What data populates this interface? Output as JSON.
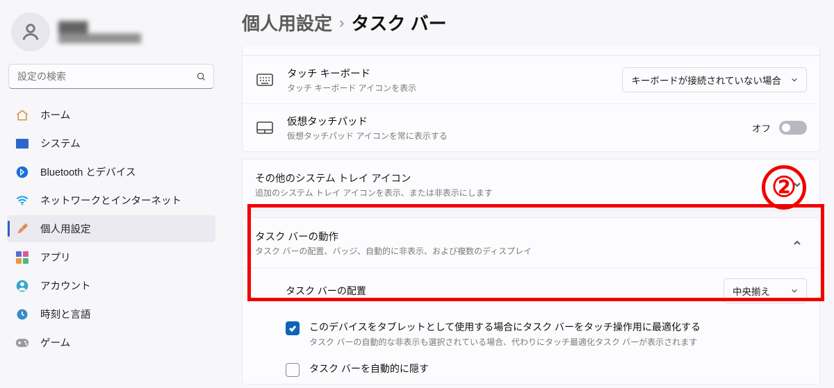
{
  "profile": {
    "name_blur": "████",
    "sub_blur": "██████████████"
  },
  "search": {
    "placeholder": "設定の検索"
  },
  "sidebar": {
    "items": [
      {
        "label": "ホーム",
        "icon": "home"
      },
      {
        "label": "システム",
        "icon": "system"
      },
      {
        "label": "Bluetooth とデバイス",
        "icon": "bt"
      },
      {
        "label": "ネットワークとインターネット",
        "icon": "wifi"
      },
      {
        "label": "個人用設定",
        "icon": "personalize",
        "active": true
      },
      {
        "label": "アプリ",
        "icon": "apps"
      },
      {
        "label": "アカウント",
        "icon": "account"
      },
      {
        "label": "時刻と言語",
        "icon": "time"
      },
      {
        "label": "ゲーム",
        "icon": "game"
      }
    ]
  },
  "breadcrumb": {
    "parent": "個人用設定",
    "sep": "›",
    "current": "タスク バー"
  },
  "rows": {
    "touch_kb": {
      "title": "タッチ キーボード",
      "sub": "タッチ キーボード アイコンを表示",
      "dropdown": "キーボードが接続されていない場合"
    },
    "vtouch": {
      "title": "仮想タッチパッド",
      "sub": "仮想タッチパッド アイコンを常に表示する",
      "toggle_label": "オフ",
      "toggle_on": false
    }
  },
  "tray": {
    "title": "その他のシステム トレイ アイコン",
    "sub": "追加のシステム トレイ アイコンを表示、または非表示にします"
  },
  "behavior": {
    "title": "タスク バーの動作",
    "sub": "タスク バーの配置、バッジ、自動的に非表示、および複数のディスプレイ",
    "alignment": {
      "label": "タスク バーの配置",
      "value": "中央揃え"
    },
    "tablet": {
      "label": "このデバイスをタブレットとして使用する場合にタスク バーをタッチ操作用に最適化する",
      "sub": "タスク バーの自動的な非表示も選択されている場合、代わりにタッチ最適化タスク バーが表示されます",
      "checked": true
    },
    "autohide": {
      "label": "タスク バーを自動的に隠す",
      "checked": false
    }
  },
  "annotation": {
    "number": "②"
  }
}
